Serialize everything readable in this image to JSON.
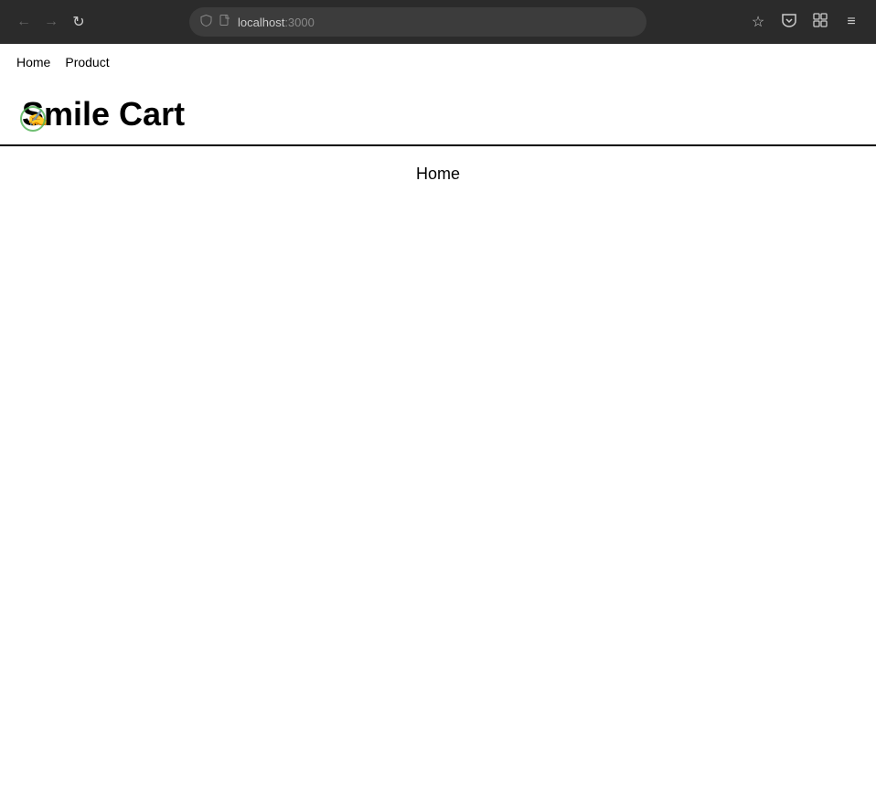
{
  "browser": {
    "url": {
      "host": "localhost",
      "port": ":3000"
    },
    "back_button": "←",
    "forward_button": "→",
    "reload_button": "↺",
    "star_icon": "☆",
    "pocket_icon": "⬡",
    "extensions_icon": "⬡",
    "menu_icon": "≡",
    "shield_icon": "⛉",
    "file_icon": "□"
  },
  "nav": {
    "home_label": "Home",
    "product_label": "Product"
  },
  "header": {
    "title": "Smile Cart"
  },
  "main": {
    "content_label": "Home"
  }
}
